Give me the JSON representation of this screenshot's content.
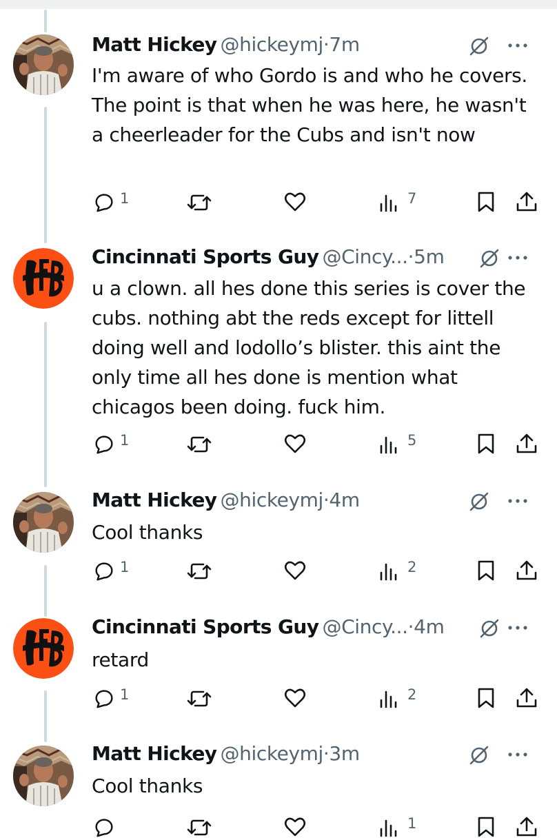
{
  "tweets": [
    {
      "avatar": "man-photo-avatar",
      "name": "Matt Hickey",
      "handle": "@hickeymj",
      "dot": "·",
      "time": "7m",
      "text": "I'm aware of who Gordo is and who he covers. The point is that when he was here, he wasn't a cheerleader for the Cubs and isn't now",
      "reply_count": "1",
      "views_count": "7"
    },
    {
      "avatar": "bengals-logo-avatar",
      "name": "Cincinnati Sports Guy",
      "handle": "@Cincy...",
      "dot": "·",
      "time": "5m",
      "text": "u a clown. all hes done this series is cover the cubs. nothing abt the reds except for littell doing well and lodollo’s blister. this aint the only time all hes done is mention what chicagos been doing. fuck him.",
      "reply_count": "1",
      "views_count": "5"
    },
    {
      "avatar": "man-photo-avatar",
      "name": "Matt Hickey",
      "handle": "@hickeymj",
      "dot": "·",
      "time": "4m",
      "text": "Cool thanks",
      "reply_count": "1",
      "views_count": "2"
    },
    {
      "avatar": "bengals-logo-avatar",
      "name": "Cincinnati Sports Guy",
      "handle": "@Cincy...",
      "dot": "·",
      "time": "4m",
      "text": "retard",
      "reply_count": "1",
      "views_count": "2"
    },
    {
      "avatar": "man-photo-avatar",
      "name": "Matt Hickey",
      "handle": "@hickeymj",
      "dot": "·",
      "time": "3m",
      "text": "Cool thanks",
      "reply_count": "",
      "views_count": "1"
    }
  ],
  "colors": {
    "text": "#0f1419",
    "muted": "#536471",
    "thread_line": "#cfd9de",
    "bengals_orange": "#fb4f14"
  },
  "icons": [
    "reply-icon",
    "repost-icon",
    "like-icon",
    "views-icon",
    "bookmark-icon",
    "share-icon",
    "grok-icon",
    "more-icon"
  ]
}
